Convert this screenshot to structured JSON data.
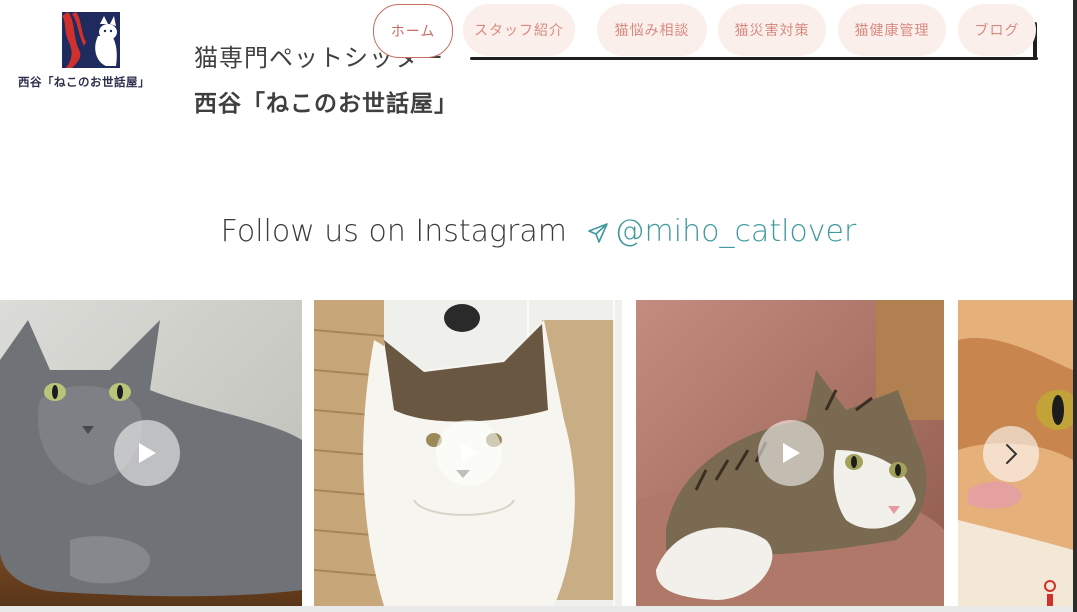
{
  "header": {
    "logo_text": "西谷「ねこのお世話屋」",
    "subtitle": "猫専門ペットシッター",
    "title": "西谷「ねこのお世話屋」"
  },
  "nav": {
    "items": [
      {
        "label": "ホーム",
        "active": true
      },
      {
        "label": "スタッフ紹介",
        "active": false
      },
      {
        "label": "猫悩み相談",
        "active": false
      },
      {
        "label": "猫災害対策",
        "active": false
      },
      {
        "label": "猫健康管理",
        "active": false
      },
      {
        "label": "ブログ",
        "active": false
      }
    ]
  },
  "instagram": {
    "lead": "Follow us on Instagram",
    "handle": "@miho_catlover",
    "icon": "send-icon",
    "posts": [
      {
        "type": "video",
        "icon": "play-icon"
      },
      {
        "type": "video",
        "icon": "play-icon"
      },
      {
        "type": "video",
        "icon": "play-icon"
      },
      {
        "type": "image"
      }
    ],
    "next_icon": "chevron-right-icon"
  },
  "colors": {
    "nav_bg": "#fbefeb",
    "nav_text": "#d98a80",
    "nav_active_border": "#c56f63",
    "handle": "#3e9a9c",
    "logo_navy": "#1f2b5e",
    "logo_red": "#d0312d"
  }
}
